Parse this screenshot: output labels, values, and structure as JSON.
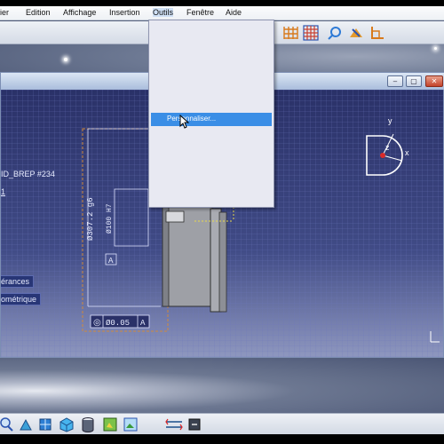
{
  "menubar": {
    "items": [
      {
        "label": "ier",
        "underline": ""
      },
      {
        "label": "Edition",
        "underline": "E"
      },
      {
        "label": "Affichage",
        "underline": "A"
      },
      {
        "label": "Insertion",
        "underline": "I"
      },
      {
        "label": "Outils",
        "underline": "O"
      },
      {
        "label": "Fenêtre",
        "underline": "F"
      },
      {
        "label": "Aide",
        "underline": "A"
      }
    ]
  },
  "dropdown": {
    "highlighted_item": "Personnaliser..."
  },
  "tree": {
    "node_part": "ID_BREP #234",
    "node_index": "1",
    "node_tolerances": "érances",
    "node_geometric": "ométrique"
  },
  "drawing": {
    "dim_diameter_outer": "Ø307.2 g6",
    "dim_diameter_inner": "Ø100 H7",
    "datum_label": "A",
    "tolerance_symbol": "◎",
    "tolerance_value": "Ø0.05",
    "tolerance_datum": "A"
  },
  "compass": {
    "axis_x": "x",
    "axis_y": "y",
    "axis_z": "z"
  },
  "colors": {
    "viewport_top": "#2a3168",
    "dropdown_highlight": "#3a8ee6",
    "dimension_line": "#dfe3ff",
    "selection_yellow": "#e8d84a",
    "frame_orange": "#d08a3c"
  },
  "icons": {
    "toolbar_top": [
      "grid-icon",
      "snap-grid-icon",
      "analysis-icon",
      "dimension-tools-icon",
      "constraint-icon"
    ],
    "toolbar_bottom": [
      "zoom-icon",
      "select-tool-icon",
      "view-cube-icon",
      "iso-view-icon",
      "cylinder-icon",
      "render-icon",
      "image-icon",
      "measure-icon",
      "command-icon"
    ]
  }
}
